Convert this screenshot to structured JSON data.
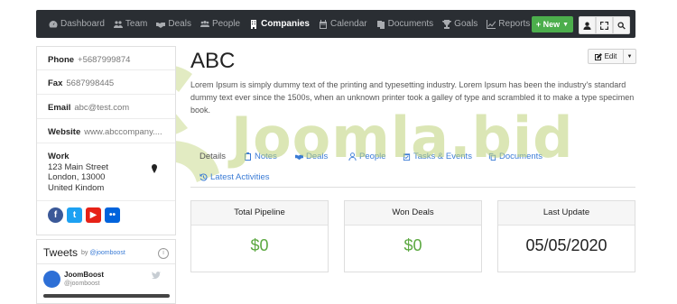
{
  "topbar": {
    "nav": [
      {
        "label": "Dashboard",
        "icon": "dashboard-icon"
      },
      {
        "label": "Team",
        "icon": "team-icon"
      },
      {
        "label": "Deals",
        "icon": "handshake-icon"
      },
      {
        "label": "People",
        "icon": "people-icon"
      },
      {
        "label": "Companies",
        "icon": "building-icon",
        "active": true
      },
      {
        "label": "Calendar",
        "icon": "calendar-icon"
      },
      {
        "label": "Documents",
        "icon": "documents-icon"
      },
      {
        "label": "Goals",
        "icon": "trophy-icon"
      },
      {
        "label": "Reports",
        "icon": "chart-icon"
      }
    ],
    "new_label": "New",
    "utility_icons": [
      "user-icon",
      "fullscreen-icon",
      "search-icon"
    ]
  },
  "contact": {
    "phone_label": "Phone",
    "phone": "+5687999874",
    "fax_label": "Fax",
    "fax": "5687998445",
    "email_label": "Email",
    "email": "abc@test.com",
    "website_label": "Website",
    "website": "www.abccompany....",
    "work_label": "Work",
    "address_lines": [
      "123 Main Street",
      "London, 13000",
      "United Kindom"
    ],
    "social": [
      "facebook-icon",
      "twitter-icon",
      "youtube-icon",
      "flickr-icon"
    ]
  },
  "tweets": {
    "title": "Tweets",
    "by_prefix": "by",
    "by_handle": "@joomboost",
    "tweet_name": "JoomBoost",
    "tweet_handle": "@joomboost"
  },
  "company": {
    "name": "ABC",
    "edit_label": "Edit",
    "description": "Lorem Ipsum is simply dummy text of the printing and typesetting industry. Lorem Ipsum has been the industry's standard dummy text ever since the 1500s, when an unknown printer took a galley of type and scrambled it to make a type specimen book."
  },
  "tabs": [
    {
      "label": "Details"
    },
    {
      "label": "Notes"
    },
    {
      "label": "Deals"
    },
    {
      "label": "People"
    },
    {
      "label": "Tasks & Events"
    },
    {
      "label": "Documents"
    },
    {
      "label": "Latest Activities"
    }
  ],
  "stats": [
    {
      "label": "Total Pipeline",
      "value": "$0"
    },
    {
      "label": "Won Deals",
      "value": "$0"
    },
    {
      "label": "Last Update",
      "value": "05/05/2020"
    }
  ],
  "watermark": "Joomla.bid",
  "colors": {
    "topbar": "#2a2e33",
    "accent_green": "#4cae4c",
    "link_blue": "#3a7bd5",
    "value_green": "#5ba840",
    "facebook": "#3b5998",
    "twitter": "#1da1f2",
    "youtube": "#e62117",
    "flickr": "#0063dc"
  }
}
